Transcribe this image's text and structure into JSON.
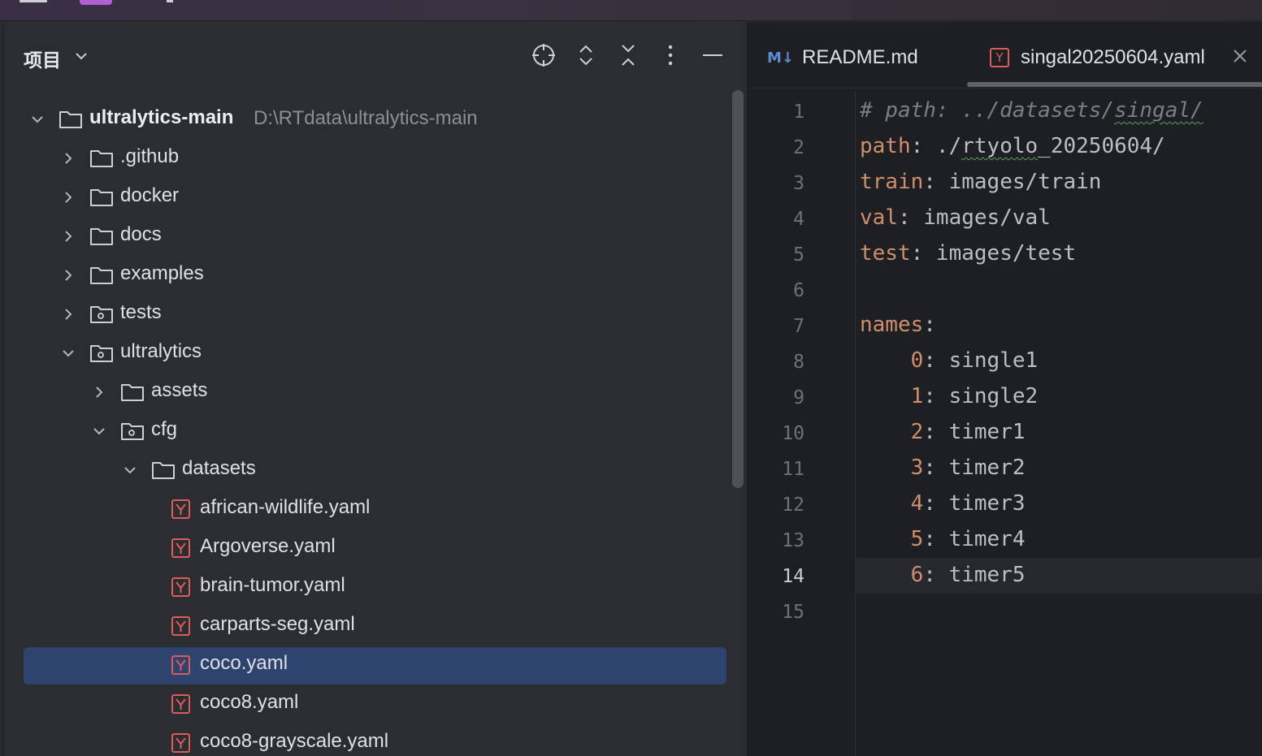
{
  "project_panel": {
    "title": "项目",
    "tree": [
      {
        "label": "ultralytics-main",
        "path": "D:\\RTdata\\ultralytics-main",
        "type": "folder",
        "expanded": true,
        "depth": 0,
        "bold": true
      },
      {
        "label": ".github",
        "type": "folder",
        "expanded": false,
        "depth": 1
      },
      {
        "label": "docker",
        "type": "folder",
        "expanded": false,
        "depth": 1
      },
      {
        "label": "docs",
        "type": "folder",
        "expanded": false,
        "depth": 1
      },
      {
        "label": "examples",
        "type": "folder",
        "expanded": false,
        "depth": 1
      },
      {
        "label": "tests",
        "type": "package",
        "expanded": false,
        "depth": 1
      },
      {
        "label": "ultralytics",
        "type": "package",
        "expanded": true,
        "depth": 1
      },
      {
        "label": "assets",
        "type": "folder",
        "expanded": false,
        "depth": 2
      },
      {
        "label": "cfg",
        "type": "package",
        "expanded": true,
        "depth": 2
      },
      {
        "label": "datasets",
        "type": "folder",
        "expanded": true,
        "depth": 3
      },
      {
        "label": "african-wildlife.yaml",
        "type": "yaml",
        "depth": 4
      },
      {
        "label": "Argoverse.yaml",
        "type": "yaml",
        "depth": 4
      },
      {
        "label": "brain-tumor.yaml",
        "type": "yaml",
        "depth": 4
      },
      {
        "label": "carparts-seg.yaml",
        "type": "yaml",
        "depth": 4
      },
      {
        "label": "coco.yaml",
        "type": "yaml",
        "depth": 4,
        "selected": true
      },
      {
        "label": "coco8.yaml",
        "type": "yaml",
        "depth": 4
      },
      {
        "label": "coco8-grayscale.yaml",
        "type": "yaml",
        "depth": 4
      }
    ]
  },
  "editor": {
    "tabs": [
      {
        "label": "README.md",
        "icon": "M↓",
        "active": false
      },
      {
        "label": "singal20250604.yaml",
        "icon": "Y",
        "active": true
      }
    ],
    "current_line": 14,
    "lines": [
      {
        "num": "1",
        "text": "# path: ../datasets/singal/"
      },
      {
        "num": "2",
        "text": "path: ./rtyolo_20250604/"
      },
      {
        "num": "3",
        "text": "train: images/train"
      },
      {
        "num": "4",
        "text": "val: images/val"
      },
      {
        "num": "5",
        "text": "test: images/test"
      },
      {
        "num": "6",
        "text": ""
      },
      {
        "num": "7",
        "text": "names:"
      },
      {
        "num": "8",
        "text": "    0: single1"
      },
      {
        "num": "9",
        "text": "    1: single2"
      },
      {
        "num": "10",
        "text": "    2: timer1"
      },
      {
        "num": "11",
        "text": "    3: timer2"
      },
      {
        "num": "12",
        "text": "    4: timer3"
      },
      {
        "num": "13",
        "text": "    5: timer4"
      },
      {
        "num": "14",
        "text": "    6: timer5"
      },
      {
        "num": "15",
        "text": ""
      }
    ]
  },
  "colors": {
    "panel_bg": "#2b2d30",
    "editor_bg": "#1e1f22",
    "selection": "#2e436e",
    "yaml_key": "#cf8e6d",
    "comment": "#7a7e85",
    "yaml_icon": "#db5c5c",
    "md_icon": "#5b8dd9"
  }
}
